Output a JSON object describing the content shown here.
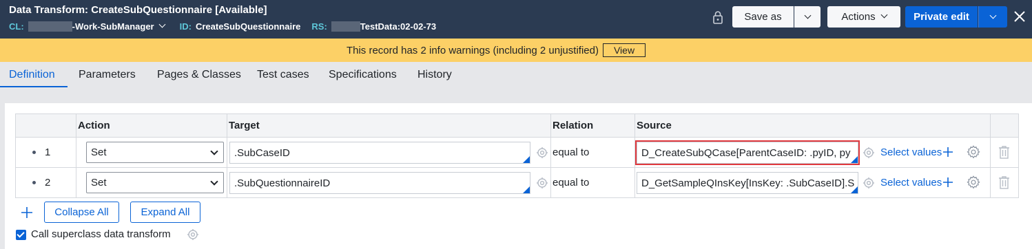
{
  "header": {
    "title": "Data Transform: CreateSubQuestionnaire [Available]",
    "cl_label": "CL:",
    "cl_value": "-Work-SubManager",
    "id_label": "ID:",
    "id_value": "CreateSubQuestionnaire",
    "rs_label": "RS:",
    "rs_value": "TestData:02-02-73",
    "save_as": "Save as",
    "actions": "Actions",
    "private_edit": "Private edit"
  },
  "banner": {
    "message": "This record has 2 info warnings (including 2 unjustified)",
    "view": "View"
  },
  "tabs": [
    "Definition",
    "Parameters",
    "Pages & Classes",
    "Test cases",
    "Specifications",
    "History"
  ],
  "grid": {
    "headers": {
      "num": "",
      "action": "Action",
      "target": "Target",
      "relation": "Relation",
      "source": "Source",
      "del": ""
    },
    "rows": [
      {
        "num": "1",
        "action": "Set",
        "target": ".SubCaseID",
        "relation": "equal to",
        "source": "D_CreateSubQCase[ParentCaseID: .pyID, py",
        "select_values": "Select values"
      },
      {
        "num": "2",
        "action": "Set",
        "target": ".SubQuestionnaireID",
        "relation": "equal to",
        "source": "D_GetSampleQInsKey[InsKey: .SubCaseID].S",
        "select_values": "Select values"
      }
    ]
  },
  "footer": {
    "collapse_all": "Collapse All",
    "expand_all": "Expand All",
    "call_superclass": "Call superclass data transform",
    "call_superclass_checked": true
  },
  "colors": {
    "header_bg": "#2b3b52",
    "banner_bg": "#fcd066",
    "accent": "#0a63d6",
    "highlight": "#e0393e"
  }
}
